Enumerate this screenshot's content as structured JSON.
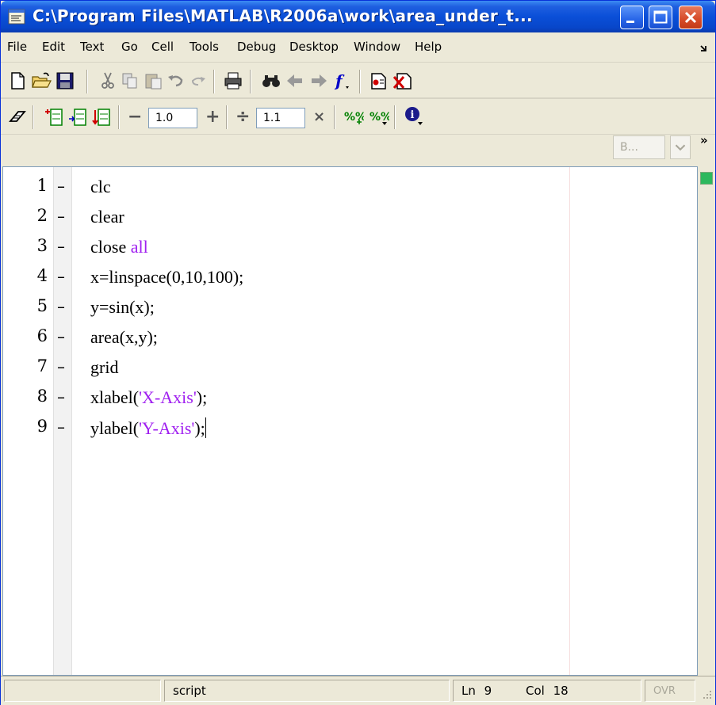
{
  "window": {
    "title": "C:\\Program Files\\MATLAB\\R2006a\\work\\area_under_t..."
  },
  "menu": {
    "items": [
      "File",
      "Edit",
      "Text",
      "Go",
      "Cell",
      "Tools",
      "Debug",
      "Desktop",
      "Window",
      "Help"
    ]
  },
  "toolbar1": {
    "combo_value": "B...",
    "icons": [
      "new-file-icon",
      "open-folder-icon",
      "save-icon",
      "cut-icon",
      "copy-icon",
      "paste-icon",
      "undo-icon",
      "redo-icon",
      "print-icon",
      "find-icon",
      "back-icon",
      "forward-icon",
      "function-icon",
      "set-breakpoint-icon",
      "clear-breakpoint-icon"
    ]
  },
  "toolbar2": {
    "decrement_symbol": "−",
    "field1_value": "1.0",
    "increment_symbol": "+",
    "divide_symbol": "÷",
    "field2_value": "1.1",
    "multiply_symbol": "×"
  },
  "editor": {
    "lines": [
      {
        "num": "1",
        "marker": "–",
        "code": "clc"
      },
      {
        "num": "2",
        "marker": "–",
        "code": "clear"
      },
      {
        "num": "3",
        "marker": "–",
        "code": "close ",
        "keyword": "all"
      },
      {
        "num": "4",
        "marker": "–",
        "code": "x=linspace(0,10,100);"
      },
      {
        "num": "5",
        "marker": "–",
        "code": "y=sin(x);"
      },
      {
        "num": "6",
        "marker": "–",
        "code": "area(x,y);"
      },
      {
        "num": "7",
        "marker": "–",
        "code": "grid"
      },
      {
        "num": "8",
        "marker": "–",
        "code_before": "xlabel(",
        "string": "'X-Axis'",
        "code_after": ");"
      },
      {
        "num": "9",
        "marker": "–",
        "code_before": "ylabel(",
        "string": "'Y-Axis'",
        "code_after": ");"
      }
    ],
    "keyword_color": "#a020f0",
    "string_color": "#a020f0",
    "status_indicator_color": "#2db85d"
  },
  "statusbar": {
    "mode": "script",
    "line_label": "Ln",
    "line_value": "9",
    "col_label": "Col",
    "col_value": "18",
    "ovr": "OVR"
  }
}
